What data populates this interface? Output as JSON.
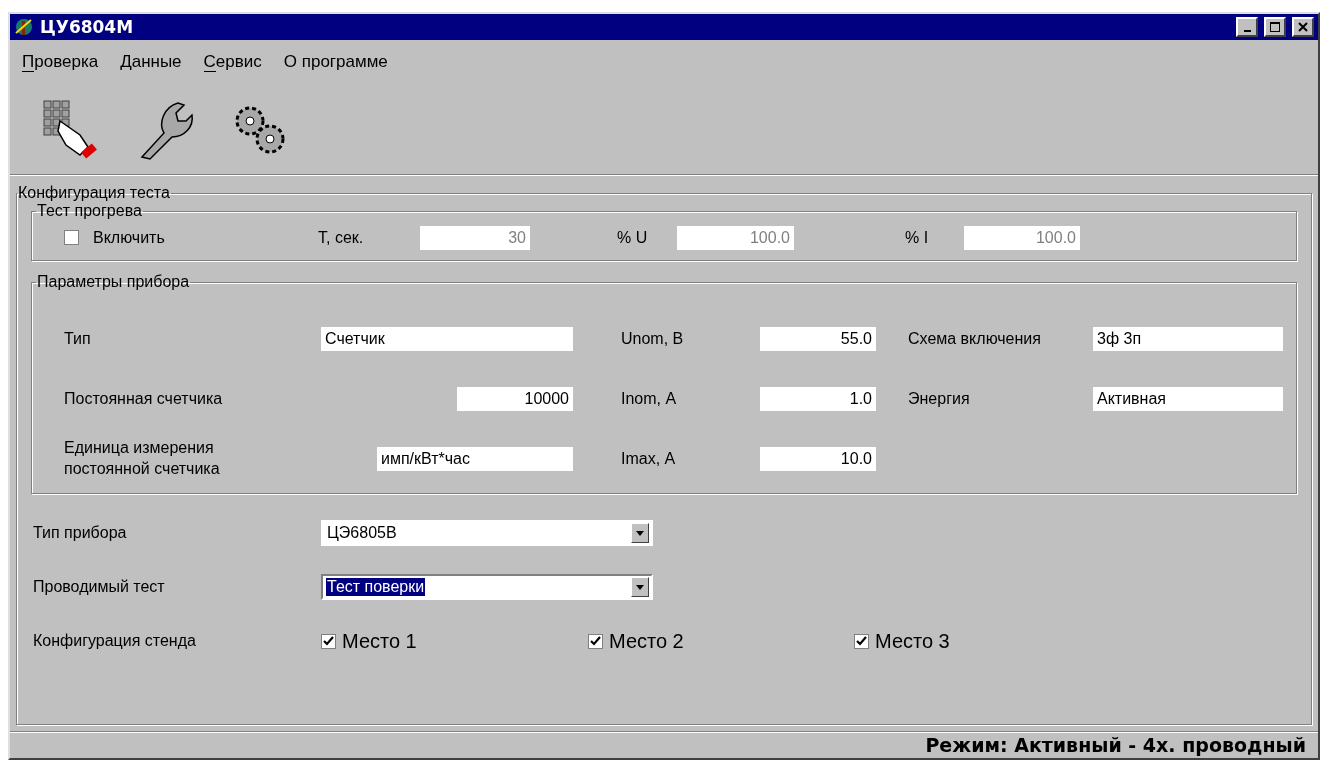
{
  "window": {
    "title": "ЦУ6804М"
  },
  "menu": [
    {
      "label": "Проверка",
      "mnemonic": true
    },
    {
      "label": "Данные",
      "mnemonic": false
    },
    {
      "label": "Сервис",
      "mnemonic": true
    },
    {
      "label": "О программе",
      "mnemonic": false
    }
  ],
  "toolbar": [
    {
      "kind": "keypad"
    },
    {
      "kind": "wrench"
    },
    {
      "kind": "gears"
    }
  ],
  "config": {
    "title": "Конфигурация теста",
    "warmup": {
      "title": "Тест прогрева",
      "enable": {
        "label": "Включить",
        "checked": false
      },
      "fields": [
        {
          "label": "T, сек.",
          "value": "30",
          "disabled": true
        },
        {
          "label": "% U",
          "value": "100.0",
          "disabled": true
        },
        {
          "label": "% I",
          "value": "100.0",
          "disabled": true
        }
      ]
    },
    "params": {
      "title": "Параметры прибора",
      "rows": [
        [
          {
            "label": "Тип",
            "value": "Счетчик",
            "kind": "text"
          },
          {
            "label": "Unom, В",
            "value": "55.0",
            "kind": "number"
          },
          {
            "label": "Схема включения",
            "value": "3ф 3п",
            "kind": "text"
          }
        ],
        [
          {
            "label": "Постоянная счетчика",
            "value": "10000",
            "kind": "number"
          },
          {
            "label": "Inom, А",
            "value": "1.0",
            "kind": "number"
          },
          {
            "label": "Энергия",
            "value": "Активная",
            "kind": "text"
          }
        ],
        [
          {
            "label": "Единица измерения\nпостоянной счетчика",
            "value": "имп/кВт*час",
            "kind": "text"
          },
          {
            "label": "Imax, А",
            "value": "10.0",
            "kind": "number"
          }
        ]
      ]
    },
    "device_type": {
      "label": "Тип прибора",
      "value": "ЦЭ6805В",
      "focused": false
    },
    "test": {
      "label": "Проводимый тест",
      "value": "Тест поверки",
      "focused": true
    },
    "stand": {
      "label": "Конфигурация стенда",
      "places": [
        {
          "label": "Место 1",
          "checked": true
        },
        {
          "label": "Место 2",
          "checked": true
        },
        {
          "label": "Место 3",
          "checked": true
        }
      ]
    }
  },
  "status_bar": {
    "mode": "Режим: Активный - 4х. проводный"
  }
}
